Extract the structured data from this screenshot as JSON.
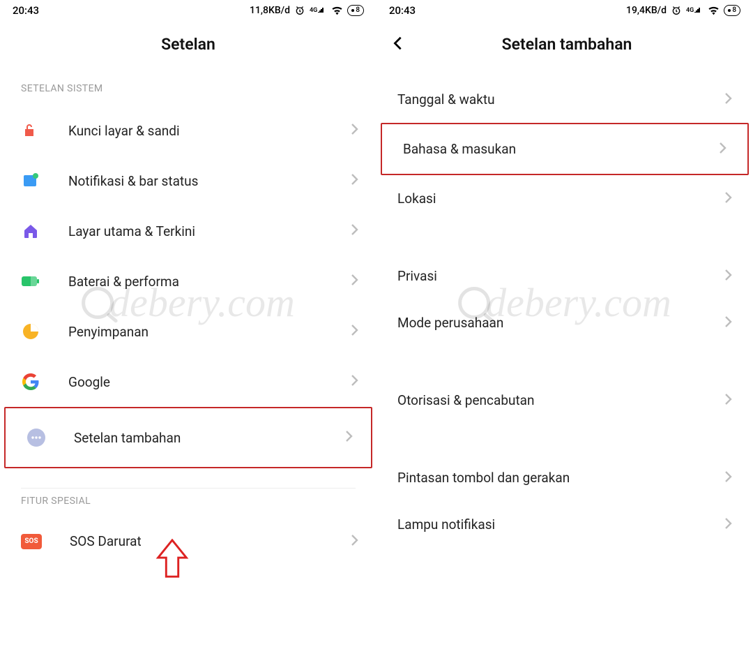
{
  "left": {
    "status": {
      "time": "20:43",
      "net": "11,8KB/d",
      "battery": "8"
    },
    "title": "Setelan",
    "section1": "SETELAN SISTEM",
    "items1": [
      {
        "label": "Kunci layar & sandi"
      },
      {
        "label": "Notifikasi & bar status"
      },
      {
        "label": "Layar utama & Terkini"
      },
      {
        "label": "Baterai & performa"
      },
      {
        "label": "Penyimpanan"
      },
      {
        "label": "Google"
      },
      {
        "label": "Setelan tambahan"
      }
    ],
    "section2": "FITUR SPESIAL",
    "items2": [
      {
        "label": "SOS Darurat"
      }
    ]
  },
  "right": {
    "status": {
      "time": "20:43",
      "net": "19,4KB/d",
      "battery": "8"
    },
    "title": "Setelan tambahan",
    "items": [
      {
        "label": "Tanggal & waktu"
      },
      {
        "label": "Bahasa & masukan"
      },
      {
        "label": "Lokasi"
      },
      {
        "label": "Privasi"
      },
      {
        "label": "Mode perusahaan"
      },
      {
        "label": "Otorisasi & pencabutan"
      },
      {
        "label": "Pintasan tombol dan gerakan"
      },
      {
        "label": "Lampu notifikasi"
      }
    ]
  },
  "watermark": "debery.com"
}
